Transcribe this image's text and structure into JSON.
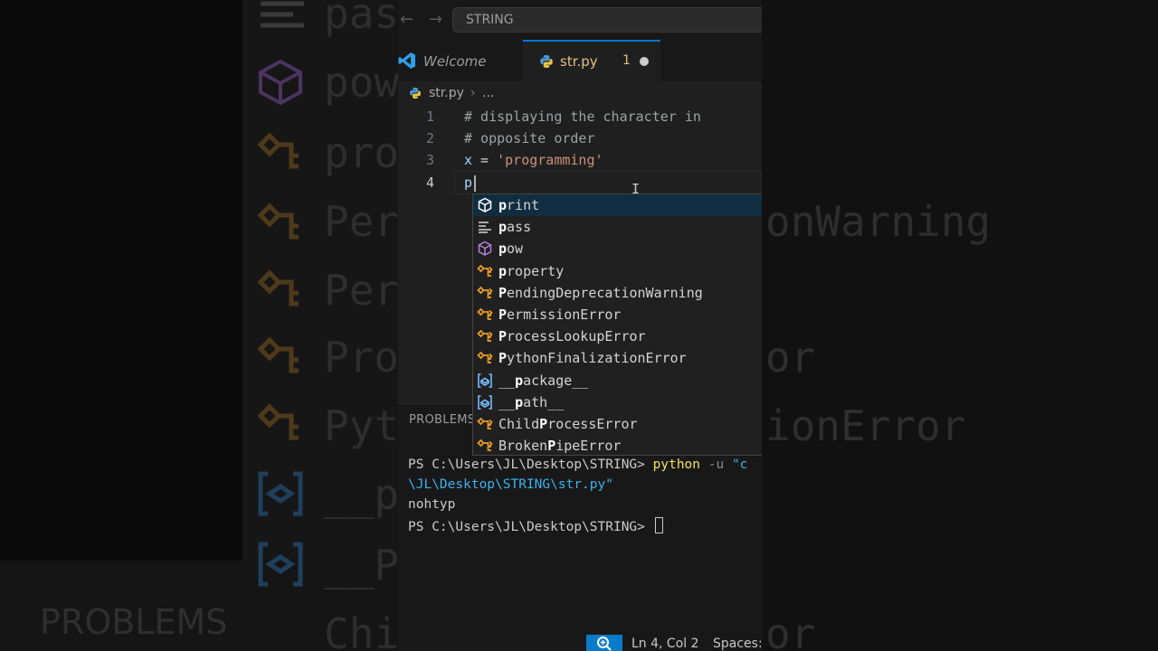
{
  "titlebar": {
    "back_icon": "arrow-left-icon",
    "forward_icon": "arrow-right-icon",
    "search_text": "STRING"
  },
  "tabs": [
    {
      "label": "Welcome",
      "icon": "vscode-logo-icon"
    },
    {
      "label": "str.py",
      "icon": "python-icon",
      "problem_count": "1",
      "dirty": true
    }
  ],
  "breadcrumb": {
    "file": "str.py",
    "rest": "..."
  },
  "editor": {
    "lines": [
      {
        "number": "1",
        "text": "# displaying the character in"
      },
      {
        "number": "2",
        "text": "# opposite order"
      },
      {
        "number": "3",
        "var": "x",
        "op": " = ",
        "string": "'programming'"
      },
      {
        "number": "4",
        "text": "p"
      }
    ]
  },
  "suggestions": [
    {
      "label": "print",
      "match": "p",
      "rest": "rint",
      "kind": "function-icon",
      "selected": true
    },
    {
      "label": "pass",
      "match": "p",
      "rest": "ass",
      "kind": "keyword-icon"
    },
    {
      "label": "pow",
      "match": "p",
      "rest": "ow",
      "kind": "method-icon"
    },
    {
      "label": "property",
      "match": "p",
      "rest": "roperty",
      "kind": "class-icon"
    },
    {
      "label": "PendingDeprecationWarning",
      "match": "P",
      "rest": "endingDeprecationWarning",
      "kind": "class-icon"
    },
    {
      "label": "PermissionError",
      "match": "P",
      "rest": "ermissionError",
      "kind": "class-icon"
    },
    {
      "label": "ProcessLookupError",
      "match": "P",
      "rest": "rocessLookupError",
      "kind": "class-icon"
    },
    {
      "label": "PythonFinalizationError",
      "match": "P",
      "rest": "ythonFinalizationError",
      "kind": "class-icon"
    },
    {
      "label": "__package__",
      "pre": "__",
      "match": "p",
      "rest": "ackage__",
      "kind": "variable-icon"
    },
    {
      "label": "__path__",
      "pre": "__",
      "match": "p",
      "rest": "ath__",
      "kind": "variable-icon"
    },
    {
      "label": "ChildProcessError",
      "pre": "Child",
      "match": "P",
      "rest": "rocessError",
      "kind": "class-icon"
    },
    {
      "label": "BrokenPipeError",
      "pre": "Broken",
      "match": "P",
      "rest": "ipeError",
      "kind": "class-icon"
    }
  ],
  "panel": {
    "tab": "PROBLEMS",
    "terminal": {
      "prompt1": "PS C:\\Users\\JL\\Desktop\\STRING> ",
      "cmd": "python",
      "flag": " -u ",
      "arg_start": "\"c",
      "path_cont": "\\JL\\Desktop\\STRING\\str.py\"",
      "output": "nohtyp",
      "prompt2": "PS C:\\Users\\JL\\Desktop\\STRING> "
    }
  },
  "statusbar": {
    "zoom_icon": "zoom-in-icon",
    "position": "Ln 4, Col 2",
    "spaces": "Spaces:"
  },
  "background": {
    "texts": [
      "pas",
      "pow",
      "pro",
      "Per",
      "Per",
      "Pro",
      "Pyt",
      "__p",
      "__P",
      "Chi",
      "onWarning",
      "or",
      "ionError",
      "or",
      "PROBLEMS"
    ]
  },
  "colors": {
    "accent": "#0078d4",
    "status_zoom": "#0a7aca",
    "comment": "#9ca3a3",
    "string": "#ce9178",
    "class_icon": "#ee9d28",
    "method_icon": "#b180d7",
    "variable_icon": "#75beff"
  }
}
